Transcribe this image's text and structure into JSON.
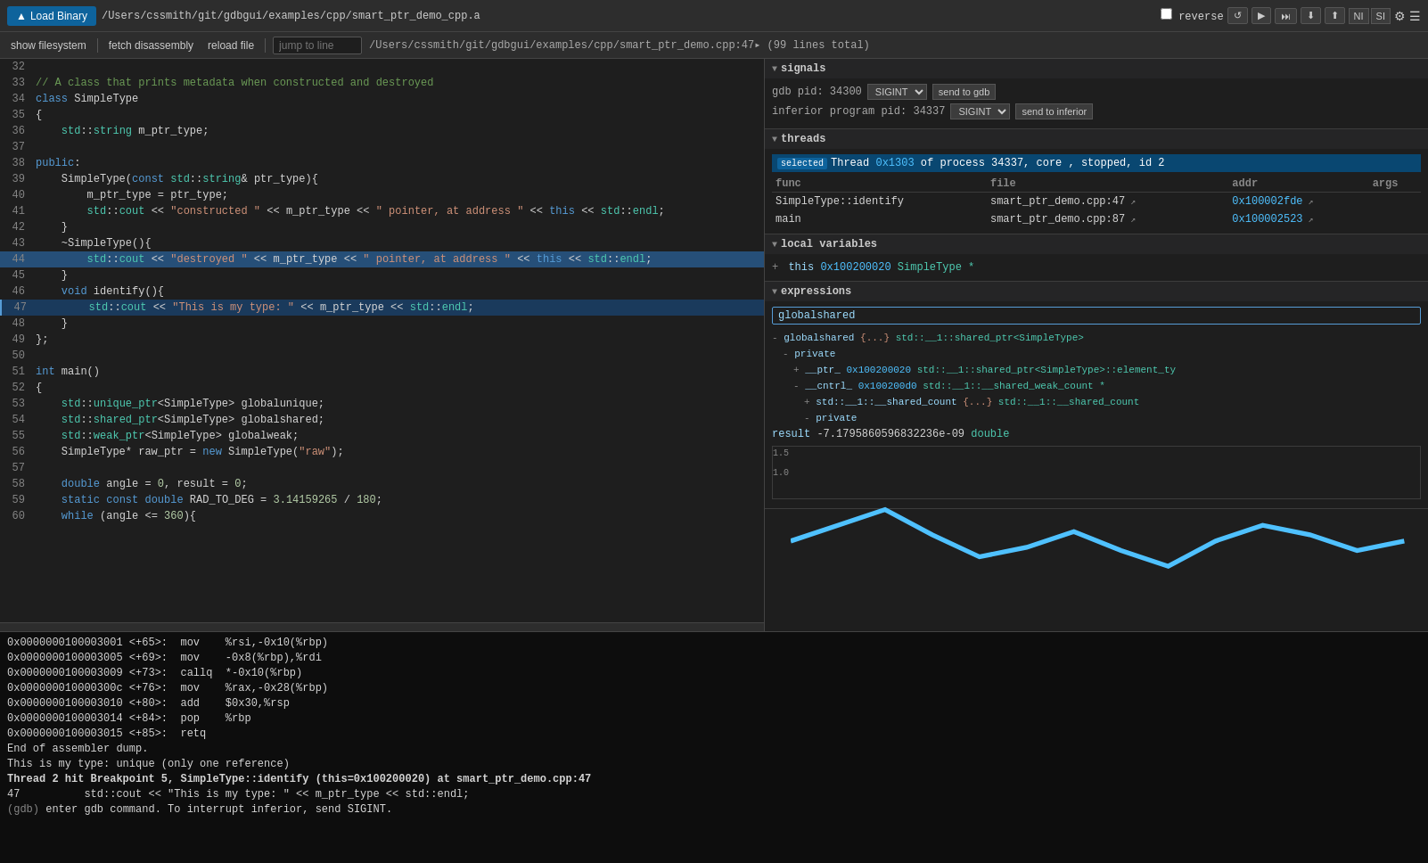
{
  "toolbar": {
    "load_btn": "Load Binary",
    "filepath": "/Users/cssmith/git/gdbgui/examples/cpp/smart_ptr_demo_cpp.a",
    "reverse_label": "reverse",
    "ctrl_btns": [
      "↺",
      "▶",
      "⏭",
      "⬇",
      "⬆"
    ],
    "ni_label": "NI",
    "si_label": "SI"
  },
  "toolbar2": {
    "show_fs": "show filesystem",
    "fetch_dis": "fetch disassembly",
    "reload_file": "reload file",
    "jump_placeholder": "jump to line",
    "filepath2": "/Users/cssmith/git/gdbgui/examples/cpp/smart_ptr_demo.cpp:47▸ (99 lines total)"
  },
  "signals": {
    "title": "signals",
    "gdb_pid_label": "gdb pid: 34300",
    "signal_select": "SIGINT",
    "send_gdb_btn": "send to gdb",
    "inferior_pid_label": "inferior program pid: 34337",
    "signal_select2": "SIGINT",
    "send_inferior_btn": "send to inferior"
  },
  "threads": {
    "title": "threads",
    "selected_badge": "selected",
    "thread_info": "Thread 0x1303 of process 34337, core , stopped, id 2",
    "thread_hex": "0x1303",
    "columns": [
      "func",
      "file",
      "addr",
      "args"
    ],
    "rows": [
      {
        "func": "SimpleType::identify",
        "file": "smart_ptr_demo.cpp:47",
        "addr": "0x100002fde",
        "args": ""
      },
      {
        "func": "main",
        "file": "smart_ptr_demo.cpp:87",
        "addr": "0x100002523",
        "args": ""
      }
    ]
  },
  "local_variables": {
    "title": "local variables",
    "vars": [
      {
        "prefix": "+ this",
        "addr": "0x100200020",
        "type": "SimpleType *"
      }
    ]
  },
  "expressions": {
    "title": "expressions",
    "input_value": "globalshared",
    "tree": [
      {
        "indent": 0,
        "prefix": "- ",
        "name": "globalshared",
        "val": "{...}",
        "type": "std::__1::shared_ptr<SimpleType>"
      },
      {
        "indent": 1,
        "prefix": "- ",
        "name": "private",
        "val": "",
        "type": ""
      },
      {
        "indent": 2,
        "prefix": "+ ",
        "name": "__ptr_",
        "addr": "0x100200020",
        "type": "std::__1::shared_ptr<SimpleType>::element_ty"
      },
      {
        "indent": 2,
        "prefix": "- ",
        "name": "__cntrl_",
        "addr": "0x100200d0",
        "type": "std::__1::__shared_weak_count *"
      },
      {
        "indent": 3,
        "prefix": "+ ",
        "name": "std::__1::__shared_count",
        "val": "{...}",
        "type": "std::__1::__shared_count"
      },
      {
        "indent": 3,
        "prefix": "- ",
        "name": "private",
        "val": "",
        "type": ""
      }
    ],
    "result_name": "result",
    "result_val": "-7.1795860596832236e-09",
    "result_type": "double"
  },
  "code_lines": [
    {
      "num": "32",
      "text": "",
      "highlight": false
    },
    {
      "num": "33",
      "text": "// A class that prints metadata when constructed and destroyed",
      "highlight": false,
      "comment": true
    },
    {
      "num": "34",
      "text": "class SimpleType",
      "highlight": false
    },
    {
      "num": "35",
      "text": "{",
      "highlight": false
    },
    {
      "num": "36",
      "text": "    std::string m_ptr_type;",
      "highlight": false
    },
    {
      "num": "37",
      "text": "",
      "highlight": false
    },
    {
      "num": "38",
      "text": "public:",
      "highlight": false
    },
    {
      "num": "39",
      "text": "    SimpleType(const std::string& ptr_type){",
      "highlight": false
    },
    {
      "num": "40",
      "text": "        m_ptr_type = ptr_type;",
      "highlight": false
    },
    {
      "num": "41",
      "text": "        std::cout << \"constructed \" << m_ptr_type << \" pointer, at address \" << this << std::endl;",
      "highlight": false
    },
    {
      "num": "42",
      "text": "    }",
      "highlight": false
    },
    {
      "num": "43",
      "text": "    ~SimpleType(){",
      "highlight": false
    },
    {
      "num": "44",
      "text": "        std::cout << \"destroyed \" << m_ptr_type << \" pointer, at address \" << this << std::endl;",
      "highlight": true
    },
    {
      "num": "45",
      "text": "    }",
      "highlight": false
    },
    {
      "num": "46",
      "text": "    void identify(){",
      "highlight": false
    },
    {
      "num": "47",
      "text": "        std::cout << \"This is my type: \" << m_ptr_type << std::endl;",
      "highlight": false,
      "current": true
    },
    {
      "num": "48",
      "text": "    }",
      "highlight": false
    },
    {
      "num": "49",
      "text": "};",
      "highlight": false
    },
    {
      "num": "50",
      "text": "",
      "highlight": false
    },
    {
      "num": "51",
      "text": "int main()",
      "highlight": false
    },
    {
      "num": "52",
      "text": "{",
      "highlight": false
    },
    {
      "num": "53",
      "text": "    std::unique_ptr<SimpleType> globalunique;",
      "highlight": false
    },
    {
      "num": "54",
      "text": "    std::shared_ptr<SimpleType> globalshared;",
      "highlight": false
    },
    {
      "num": "55",
      "text": "    std::weak_ptr<SimpleType> globalweak;",
      "highlight": false
    },
    {
      "num": "56",
      "text": "    SimpleType* raw_ptr = new SimpleType(\"raw\");",
      "highlight": false
    },
    {
      "num": "57",
      "text": "",
      "highlight": false
    },
    {
      "num": "58",
      "text": "    double angle = 0, result = 0;",
      "highlight": false
    },
    {
      "num": "59",
      "text": "    static const double RAD_TO_DEG = 3.14159265 / 180;",
      "highlight": false
    },
    {
      "num": "60",
      "text": "    while (angle <= 360){",
      "highlight": false
    }
  ],
  "terminal_lines": [
    "0x0000000100003001 <+65>:  mov    %rsi,-0x10(%rbp)",
    "0x0000000100003005 <+69>:  mov    -0x8(%rbp),%rdi",
    "0x0000000100003009 <+73>:  callq  *-0x10(%rbp)",
    "0x000000010000300c <+76>:  mov    %rax,-0x28(%rbp)",
    "0x0000000100003010 <+80>:  add    $0x30,%rsp",
    "0x0000000100003014 <+84>:  pop    %rbp",
    "0x0000000100003015 <+85>:  retq",
    "End of assembler dump.",
    "This is my type: unique (only one reference)",
    "",
    "Thread 2 hit Breakpoint 5, SimpleType::identify (this=0x100200020) at smart_ptr_demo.cpp:47",
    "47          std::cout << \"This is my type: \" << m_ptr_type << std::endl;",
    "",
    "(gdb) enter gdb command. To interrupt inferior, send SIGINT."
  ]
}
